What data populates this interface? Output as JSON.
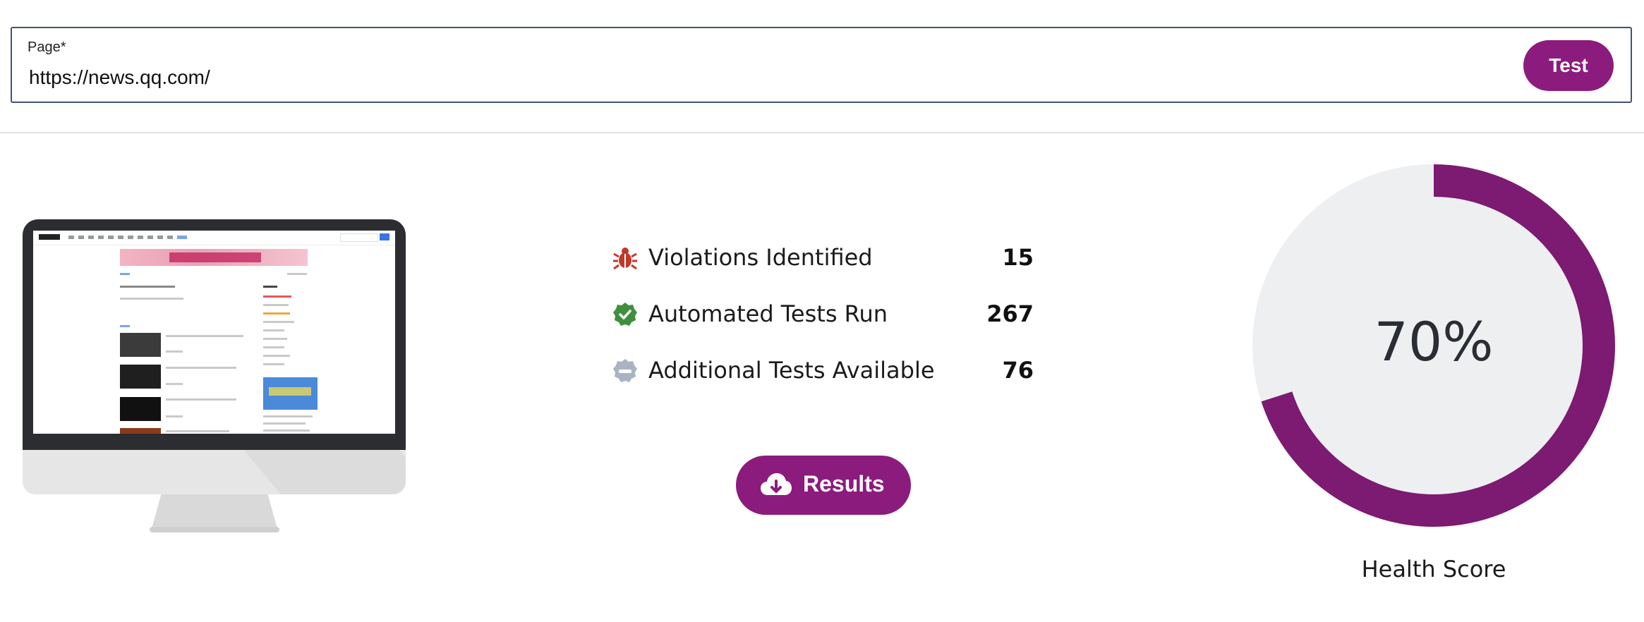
{
  "page_field": {
    "label": "Page",
    "required_marker": "*",
    "value": "https://news.qq.com/"
  },
  "test_button": {
    "label": "Test"
  },
  "stats": [
    {
      "icon": "bug-icon",
      "label": "Violations Identified",
      "value": "15",
      "color": "#c0392b"
    },
    {
      "icon": "check-badge-icon",
      "label": "Automated Tests Run",
      "value": "267",
      "color": "#3f8f3f"
    },
    {
      "icon": "minus-badge-icon",
      "label": "Additional Tests Available",
      "value": "76",
      "color": "#a9b4c2"
    }
  ],
  "results_button": {
    "label": "Results",
    "icon": "cloud-download-icon"
  },
  "health": {
    "percent": 70,
    "display": "70%",
    "label": "Health Score",
    "fill_color": "#7d1a72",
    "track_color": "#eeeff1"
  },
  "colors": {
    "accent": "#8c1b7e",
    "field_border": "#3e5570"
  }
}
